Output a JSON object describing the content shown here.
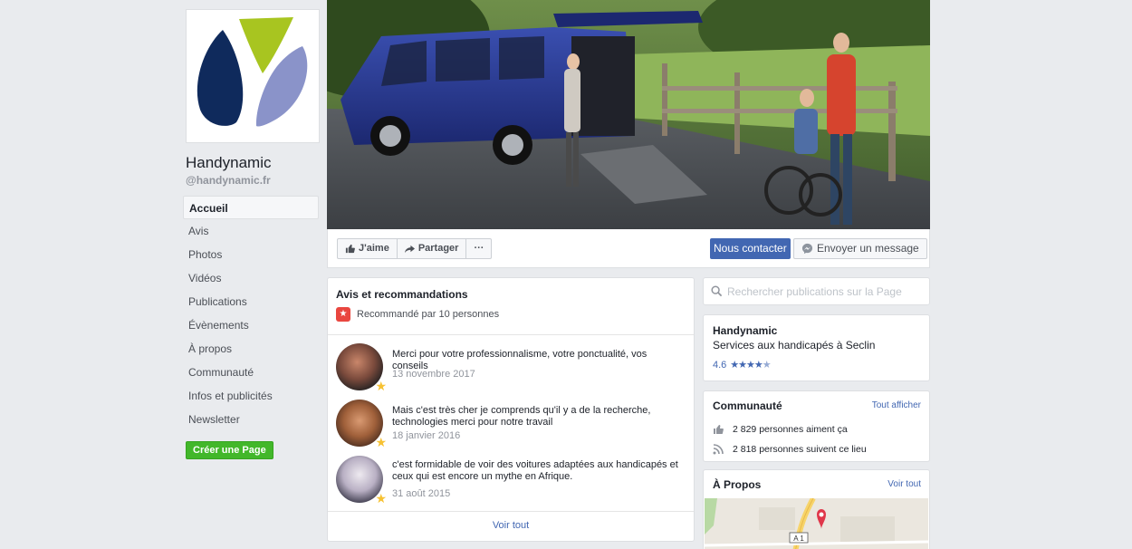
{
  "page": {
    "name": "Handynamic",
    "handle": "@handynamic.fr"
  },
  "nav": {
    "items": [
      "Accueil",
      "Avis",
      "Photos",
      "Vidéos",
      "Publications",
      "Évènements",
      "À propos",
      "Communauté",
      "Infos et publicités",
      "Newsletter"
    ],
    "active": "Accueil",
    "create_page": "Créer une Page"
  },
  "actions": {
    "like": "J'aime",
    "share": "Partager",
    "more": "···",
    "contact": "Nous contacter",
    "message": "Envoyer un message"
  },
  "reviews": {
    "title": "Avis et recommandations",
    "recommended": "Recommandé par 10 personnes",
    "items": [
      {
        "text": "Merci pour votre professionnalisme, votre ponctualité, vos conseils",
        "date": "13 novembre 2017"
      },
      {
        "text": "Mais c'est très cher je comprends qu'il y a de la recherche, technologies merci pour notre travail",
        "date": "18 janvier 2016"
      },
      {
        "text": "c'est formidable de voir des voitures adaptées aux handicapés et ceux qui est encore un mythe en Afrique.",
        "date": "31 août 2015"
      }
    ],
    "see_all": "Voir tout"
  },
  "search": {
    "placeholder": "Rechercher publications sur la Page"
  },
  "info": {
    "name": "Handynamic",
    "category": "Services aux handicapés à Seclin",
    "rating": "4.6",
    "stars": 4.6
  },
  "community": {
    "title": "Communauté",
    "link": "Tout afficher",
    "likes": "2 829 personnes aiment ça",
    "follows": "2 818 personnes suivent ce lieu"
  },
  "about": {
    "title": "À Propos",
    "link": "Voir tout",
    "road_label": "A 1"
  },
  "colors": {
    "brand_blue": "#4267b2",
    "green": "#42b72a",
    "background": "#e9ebee",
    "logo_navy": "#0f2a5c",
    "logo_lime": "#a8c520",
    "logo_lavender": "#8a93c9"
  }
}
